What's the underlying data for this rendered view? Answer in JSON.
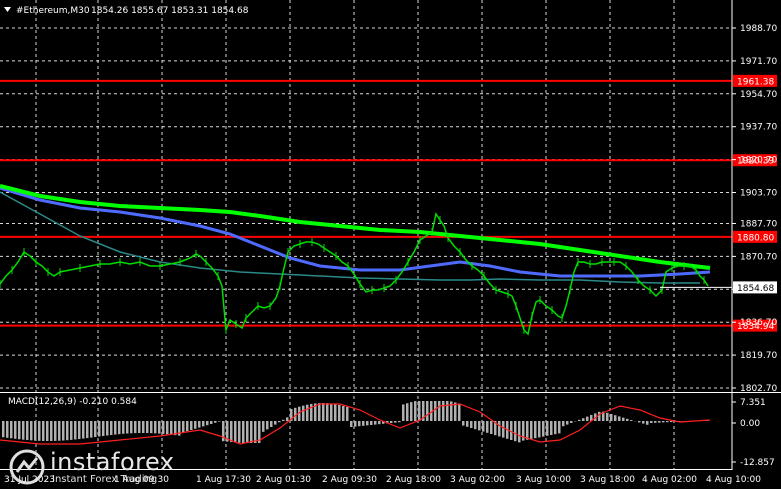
{
  "header": {
    "symbol": "#Ethereum,M30",
    "ohlc": "1854.26 1855.67 1853.31 1854.68",
    "icon": "chart-dropdown-triangle-icon"
  },
  "price_axis": {
    "ticks": [
      "1988.70",
      "1971.70",
      "1954.70",
      "1937.70",
      "1920.70",
      "1903.70",
      "1887.70",
      "1870.70",
      "1853.70",
      "1836.70",
      "1819.70",
      "1802.70"
    ],
    "current_price": "1854.68"
  },
  "levels": [
    {
      "label": "1961.38",
      "value": 1961.38
    },
    {
      "label": "1920.39",
      "value": 1920.39
    },
    {
      "label": "1880.80",
      "value": 1880.8
    },
    {
      "label": "1834.94",
      "value": 1834.94
    }
  ],
  "macd": {
    "label": "MACD(12,26,9) -0.210 0.584",
    "ticks": [
      "7.351",
      "0.00",
      "-12.857"
    ]
  },
  "time_axis": {
    "ticks": [
      "31 Jul 2023",
      "1 Aug 09:30",
      "1 Aug 17:30",
      "2 Aug 01:30",
      "2 Aug 09:30",
      "2 Aug 18:00",
      "3 Aug 02:00",
      "3 Aug 10:00",
      "3 Aug 18:00",
      "4 Aug 02:00",
      "4 Aug 10:00"
    ]
  },
  "logo": {
    "brand": "instaforex",
    "tagline": "Instant Forex Trading",
    "icon": "instaforex-logo-icon"
  },
  "colors": {
    "background": "#000000",
    "level_line": "#ff0000",
    "price_line": "#00dd00",
    "ma_fast": "#00ff00",
    "ma_slow": "#4f6bff",
    "ma_teal": "#2a8a8a",
    "macd_hist": "#b0b0b0",
    "macd_signal": "#ff2020",
    "grid": "#ffffff"
  }
}
